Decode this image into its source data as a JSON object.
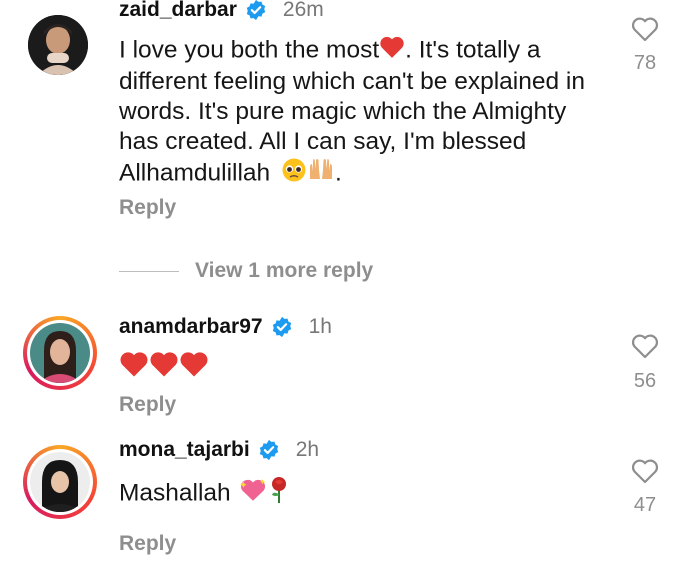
{
  "comments": [
    {
      "username": "zaid_darbar",
      "time": "26m",
      "text_lines": [
        "I love you both the most",
        ". It's totally a",
        "different feeling which can't be explained in",
        "words. It's pure magic which the Almighty",
        "has created. All I can say, I'm blessed",
        "Allhamdulillah",
        "."
      ],
      "reply_label": "Reply",
      "likes": "78"
    },
    {
      "username": "anamdarbar97",
      "time": "1h",
      "reply_label": "Reply",
      "likes": "56"
    },
    {
      "username": "mona_tajarbi",
      "time": "2h",
      "text": "Mashallah",
      "reply_label": "Reply",
      "likes": "47"
    }
  ],
  "view_more_replies": "View 1 more reply",
  "colors": {
    "verified": "#1d9bf0",
    "heart_emoji": "#e53935",
    "secondary_text": "#8e8e8e"
  }
}
